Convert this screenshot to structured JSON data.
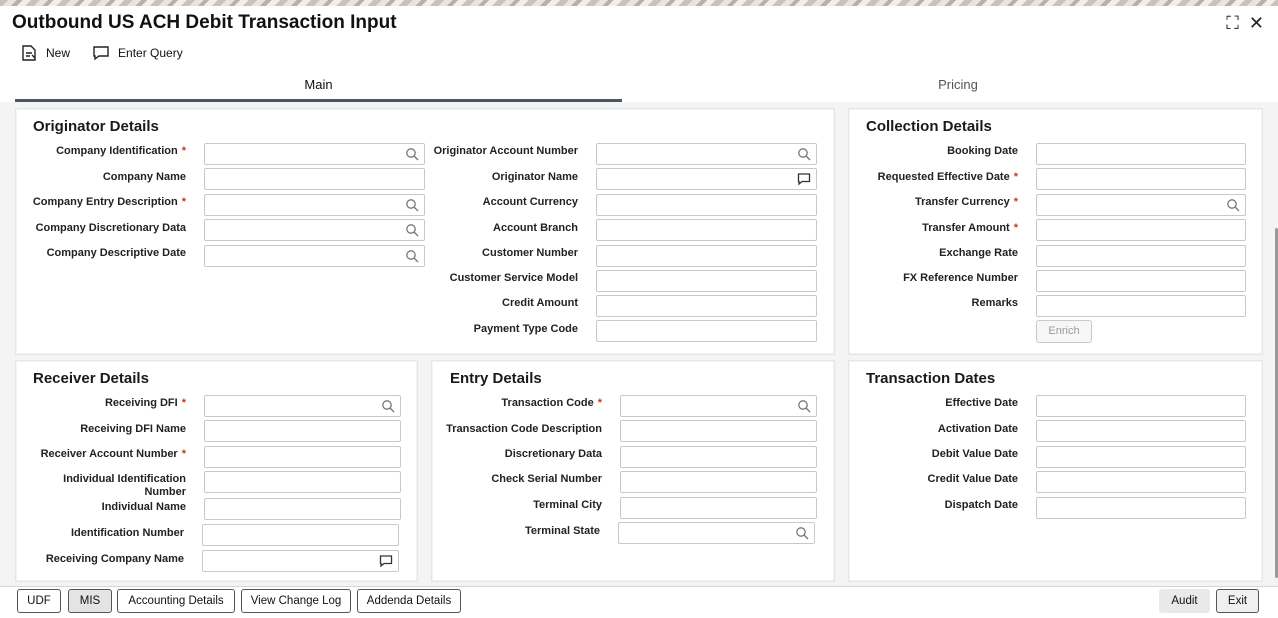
{
  "window": {
    "title": "Outbound US ACH Debit Transaction Input",
    "maximize_icon": "⛶",
    "close_icon": "✕"
  },
  "toolbar": {
    "new_label": "New",
    "enter_query_label": "Enter Query"
  },
  "tabs": {
    "main": "Main",
    "pricing": "Pricing"
  },
  "originator": {
    "title": "Originator Details",
    "company_identification": "Company Identification",
    "company_name": "Company Name",
    "company_entry_description": "Company Entry Description",
    "company_discretionary_data": "Company Discretionary Data",
    "company_descriptive_date": "Company Descriptive Date",
    "originator_account_number": "Originator Account Number",
    "originator_name": "Originator Name",
    "account_currency": "Account Currency",
    "account_branch": "Account Branch",
    "customer_number": "Customer Number",
    "customer_service_model": "Customer Service Model",
    "credit_amount": "Credit Amount",
    "payment_type_code": "Payment Type Code"
  },
  "collection": {
    "title": "Collection Details",
    "booking_date": "Booking Date",
    "requested_effective_date": "Requested Effective Date",
    "transfer_currency": "Transfer Currency",
    "transfer_amount": "Transfer Amount",
    "exchange_rate": "Exchange Rate",
    "fx_reference_number": "FX Reference Number",
    "remarks": "Remarks",
    "enrich_button": "Enrich"
  },
  "receiver": {
    "title": "Receiver Details",
    "receiving_dfi": "Receiving DFI",
    "receiving_dfi_name": "Receiving DFI Name",
    "receiver_account_number": "Receiver Account Number",
    "individual_identification_number_line1": "Individual Identification",
    "individual_identification_number_line2": "Number",
    "individual_name": "Individual Name",
    "identification_number": "Identification Number",
    "receiving_company_name": "Receiving Company Name"
  },
  "entry": {
    "title": "Entry Details",
    "transaction_code": "Transaction Code",
    "transaction_code_description": "Transaction Code Description",
    "discretionary_data": "Discretionary Data",
    "check_serial_number": "Check Serial Number",
    "terminal_city": "Terminal City",
    "terminal_state": "Terminal State"
  },
  "dates": {
    "title": "Transaction Dates",
    "effective_date": "Effective Date",
    "activation_date": "Activation Date",
    "debit_value_date": "Debit Value Date",
    "credit_value_date": "Credit Value Date",
    "dispatch_date": "Dispatch Date"
  },
  "required_marker": "*",
  "footer": {
    "udf": "UDF",
    "mis": "MIS",
    "accounting_details": "Accounting Details",
    "view_change_log": "View Change Log",
    "addenda_details": "Addenda Details",
    "audit": "Audit",
    "exit": "Exit"
  }
}
